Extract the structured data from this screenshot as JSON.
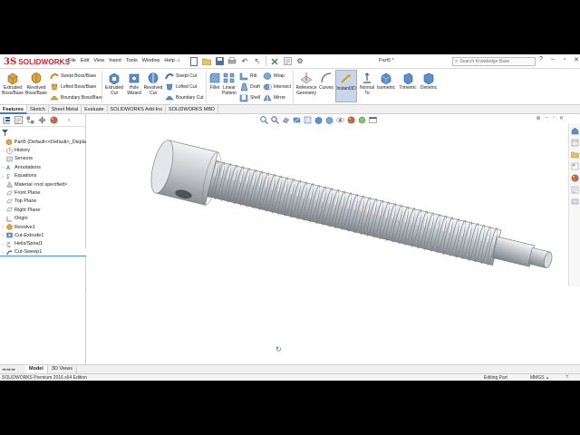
{
  "app": {
    "logo_mark": "3S",
    "logo_text": "SOLIDWORKS",
    "menu": [
      "File",
      "Edit",
      "View",
      "Insert",
      "Tools",
      "Window",
      "Help"
    ],
    "document_title": "Part5 *",
    "search_placeholder": "Search Knowledge Base",
    "window_controls": [
      "?",
      "–",
      "▫",
      "✕"
    ]
  },
  "toolbar": {
    "extruded_boss": "Extruded\nBoss/Base",
    "revolved_boss": "Revolved\nBoss/Base",
    "swept_boss": "Swept Boss/Base",
    "lofted_boss": "Lofted Boss/Base",
    "boundary_boss": "Boundary Boss/Base",
    "extruded_cut": "Extruded\nCut",
    "hole_wizard": "Hole\nWizard",
    "revolved_cut": "Revolved\nCut",
    "swept_cut": "Swept Cut",
    "lofted_cut": "Lofted Cut",
    "boundary_cut": "Boundary Cut",
    "fillet": "Fillet",
    "linear_pattern": "Linear\nPattern",
    "rib": "Rib",
    "draft": "Draft",
    "shell": "Shell",
    "wrap": "Wrap",
    "intersect": "Intersect",
    "mirror": "Mirror",
    "reference_geometry": "Reference\nGeometry",
    "curves": "Curves",
    "instant3d": "Instant3D",
    "normal_to": "Normal\nTo",
    "isometric": "Isometric",
    "trimetric": "Trimetric",
    "dimetric": "Dimetric"
  },
  "command_tabs": [
    "Features",
    "Sketch",
    "Sheet Metal",
    "Evaluate",
    "SOLIDWORKS Add-Ins",
    "SOLIDWORKS MBD"
  ],
  "tree": {
    "root": "Part5  (Default<<Default>_Displa",
    "items": [
      "History",
      "Sensors",
      "Annotations",
      "Equations",
      "Material <not specified>",
      "Front Plane",
      "Top Plane",
      "Right Plane",
      "Origin",
      "Revolve1",
      "Cut-Extrude1",
      "Helix/Spiral1",
      "Cut-Sweep1"
    ]
  },
  "bottom_tabs": [
    "Model",
    "3D Views"
  ],
  "bottom_nav": "◂◂ ◂ ▸ ▸▸",
  "status": {
    "left": "SOLIDWORKS Premium 2016 x64 Edition",
    "mode": "Editing Part",
    "units": "MMGS",
    "arrow": "▲",
    "help": "?"
  },
  "colors": {
    "brand_red": "#d0202a",
    "accent_blue": "#3d7bc8",
    "part_gray": "#a9adb3"
  }
}
